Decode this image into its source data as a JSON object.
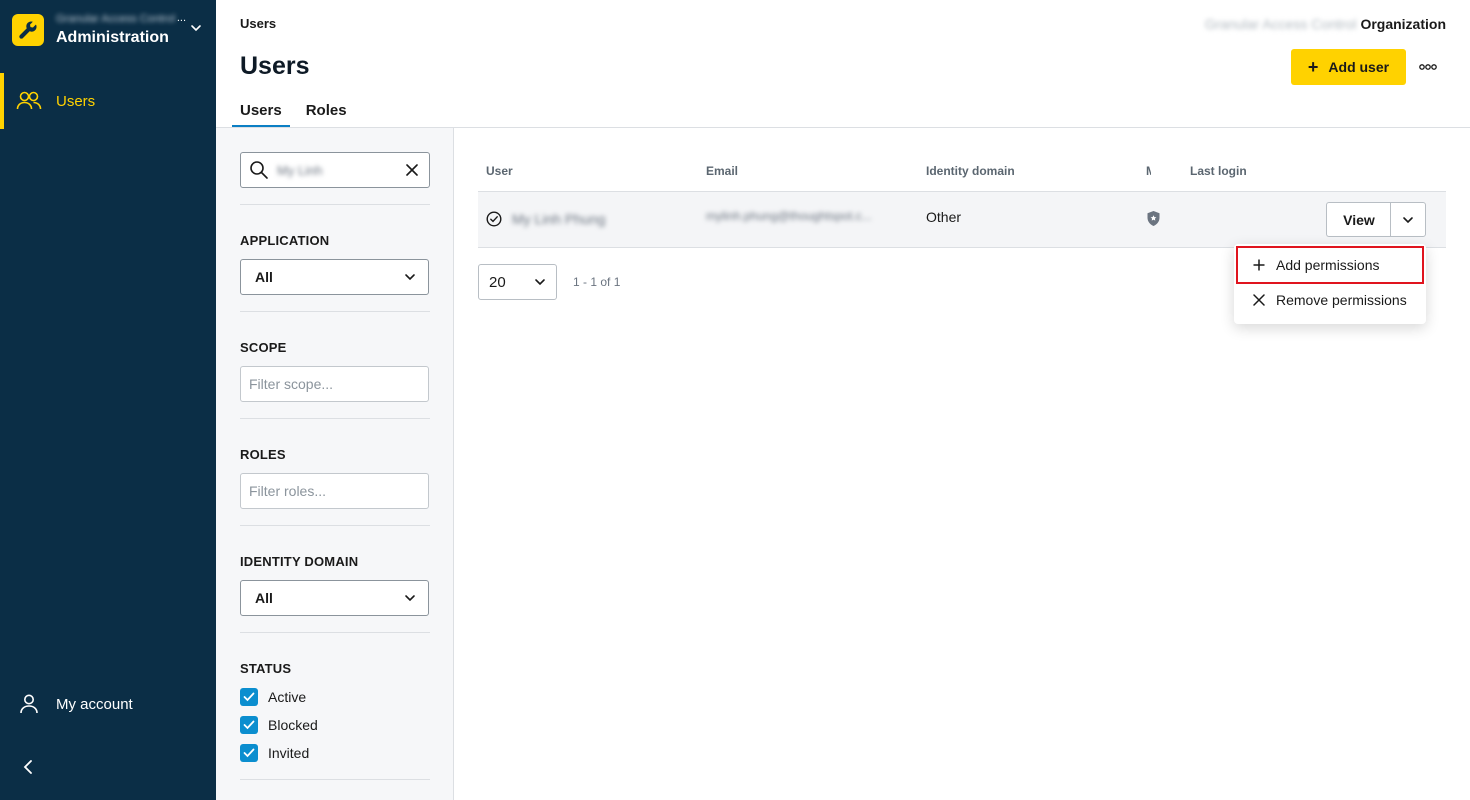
{
  "sidebar": {
    "org_name": "Granular Access Control",
    "org_overflow": "...",
    "app_title": "Administration",
    "nav": [
      {
        "label": "Users",
        "icon": "users-icon",
        "active": true
      }
    ],
    "account_label": "My account"
  },
  "header": {
    "breadcrumb": "Users",
    "page_title": "Users",
    "org_context": "Granular Access Control",
    "org_label": "Organization",
    "add_user_label": "Add user",
    "tabs": [
      {
        "label": "Users",
        "active": true
      },
      {
        "label": "Roles",
        "active": false
      }
    ]
  },
  "filters": {
    "search_value": "My Linh",
    "application": {
      "label": "APPLICATION",
      "selected": "All"
    },
    "scope": {
      "label": "SCOPE",
      "placeholder": "Filter scope..."
    },
    "roles": {
      "label": "ROLES",
      "placeholder": "Filter roles..."
    },
    "identity_domain": {
      "label": "IDENTITY DOMAIN",
      "selected": "All"
    },
    "status": {
      "label": "STATUS",
      "options": [
        {
          "label": "Active",
          "checked": true
        },
        {
          "label": "Blocked",
          "checked": true
        },
        {
          "label": "Invited",
          "checked": true
        }
      ]
    }
  },
  "table": {
    "columns": [
      "User",
      "Email",
      "Identity domain",
      "M",
      "Last login"
    ],
    "rows": [
      {
        "user": "My Linh Phung",
        "email": "mylinh.phung@thoughtspot.c...",
        "identity_domain": "Other",
        "mfa_icon": "shield-icon",
        "last_login": "",
        "view_label": "View"
      }
    ]
  },
  "pagination": {
    "page_size": "20",
    "range": "1 - 1 of 1"
  },
  "row_menu": {
    "items": [
      {
        "label": "Add permissions",
        "icon": "plus-icon",
        "highlighted": true
      },
      {
        "label": "Remove permissions",
        "icon": "close-icon",
        "highlighted": false
      }
    ]
  },
  "colors": {
    "sidebar_bg": "#0b2e46",
    "accent_yellow": "#ffd200",
    "tab_underline": "#0b7fc4",
    "checkbox_blue": "#0b8ecf",
    "highlight_red": "#e0141e"
  }
}
